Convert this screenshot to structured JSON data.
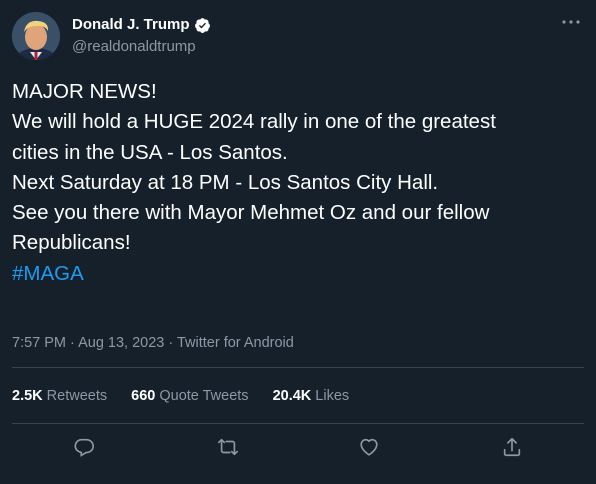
{
  "user": {
    "display_name": "Donald J. Trump",
    "handle": "@realdonaldtrump",
    "verified": true
  },
  "tweet": {
    "lines": [
      "MAJOR NEWS!",
      "We will hold a HUGE 2024 rally in one of the greatest",
      "cities in the USA - Los Santos.",
      "Next Saturday at 18 PM - Los Santos City Hall.",
      "See you there with Mayor Mehmet Oz and our fellow",
      "Republicans!"
    ],
    "hashtag": "#MAGA",
    "meta": "7:57 PM · Aug 13, 2023 · Twitter for Android"
  },
  "stats": {
    "retweets_count": "2.5K",
    "retweets_label": "Retweets",
    "quotes_count": "660",
    "quotes_label": "Quote Tweets",
    "likes_count": "20.4K",
    "likes_label": "Likes"
  },
  "colors": {
    "background": "#15202b",
    "text": "#ffffff",
    "secondary": "#8b98a5",
    "accent": "#1d9bf0",
    "divider": "#38444d"
  },
  "icons": [
    "more-icon",
    "verified-badge-icon",
    "reply-icon",
    "retweet-icon",
    "like-icon",
    "share-icon"
  ]
}
